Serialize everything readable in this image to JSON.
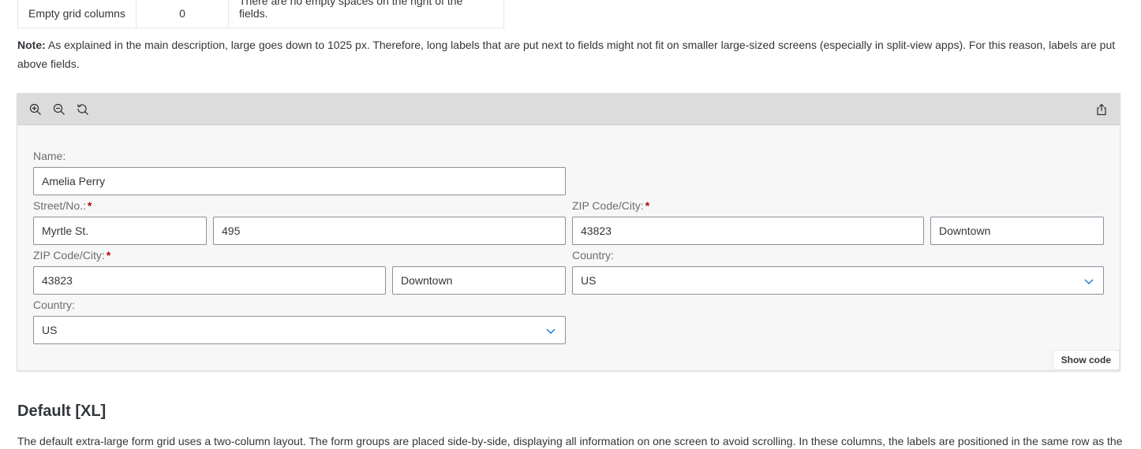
{
  "table": {
    "row": [
      "Empty grid columns",
      "0",
      "There are no empty spaces on the right of the fields."
    ]
  },
  "note": {
    "label": "Note:",
    "text": " As explained in the main description, large goes down to 1025 px. Therefore, long labels that are put next to fields might not fit on smaller large-sized screens (especially in split-view apps). For this reason, labels are put above fields."
  },
  "toolbar": {
    "icons": [
      "zoom-in-icon",
      "zoom-out-icon",
      "reset-zoom-icon",
      "share-icon"
    ]
  },
  "form": {
    "name_label": "Name:",
    "name_value": "Amelia Perry",
    "street_label": "Street/No.:",
    "street_value": "Myrtle St.",
    "number_value": "495",
    "zip_label_right": "ZIP Code/City:",
    "zip_value_right": "43823",
    "city_value_right": "Downtown",
    "zip_label_left": "ZIP Code/City:",
    "zip_value_left": "43823",
    "city_value_left": "Downtown",
    "country_label_right": "Country:",
    "country_value_right": "US",
    "country_label_left": "Country:",
    "country_value_left": "US",
    "required_mark": "*"
  },
  "show_code_label": "Show code",
  "section": {
    "title": "Default [XL]",
    "description": "The default extra-large form grid uses a two-column layout. The form groups are placed side-by-side, displaying all information on one screen to avoid scrolling. In these columns, the labels are positioned in the same row as the"
  },
  "colors": {
    "required": "#bb0000",
    "toolbar_bg": "#dcdcdc",
    "input_border": "#89919a"
  }
}
